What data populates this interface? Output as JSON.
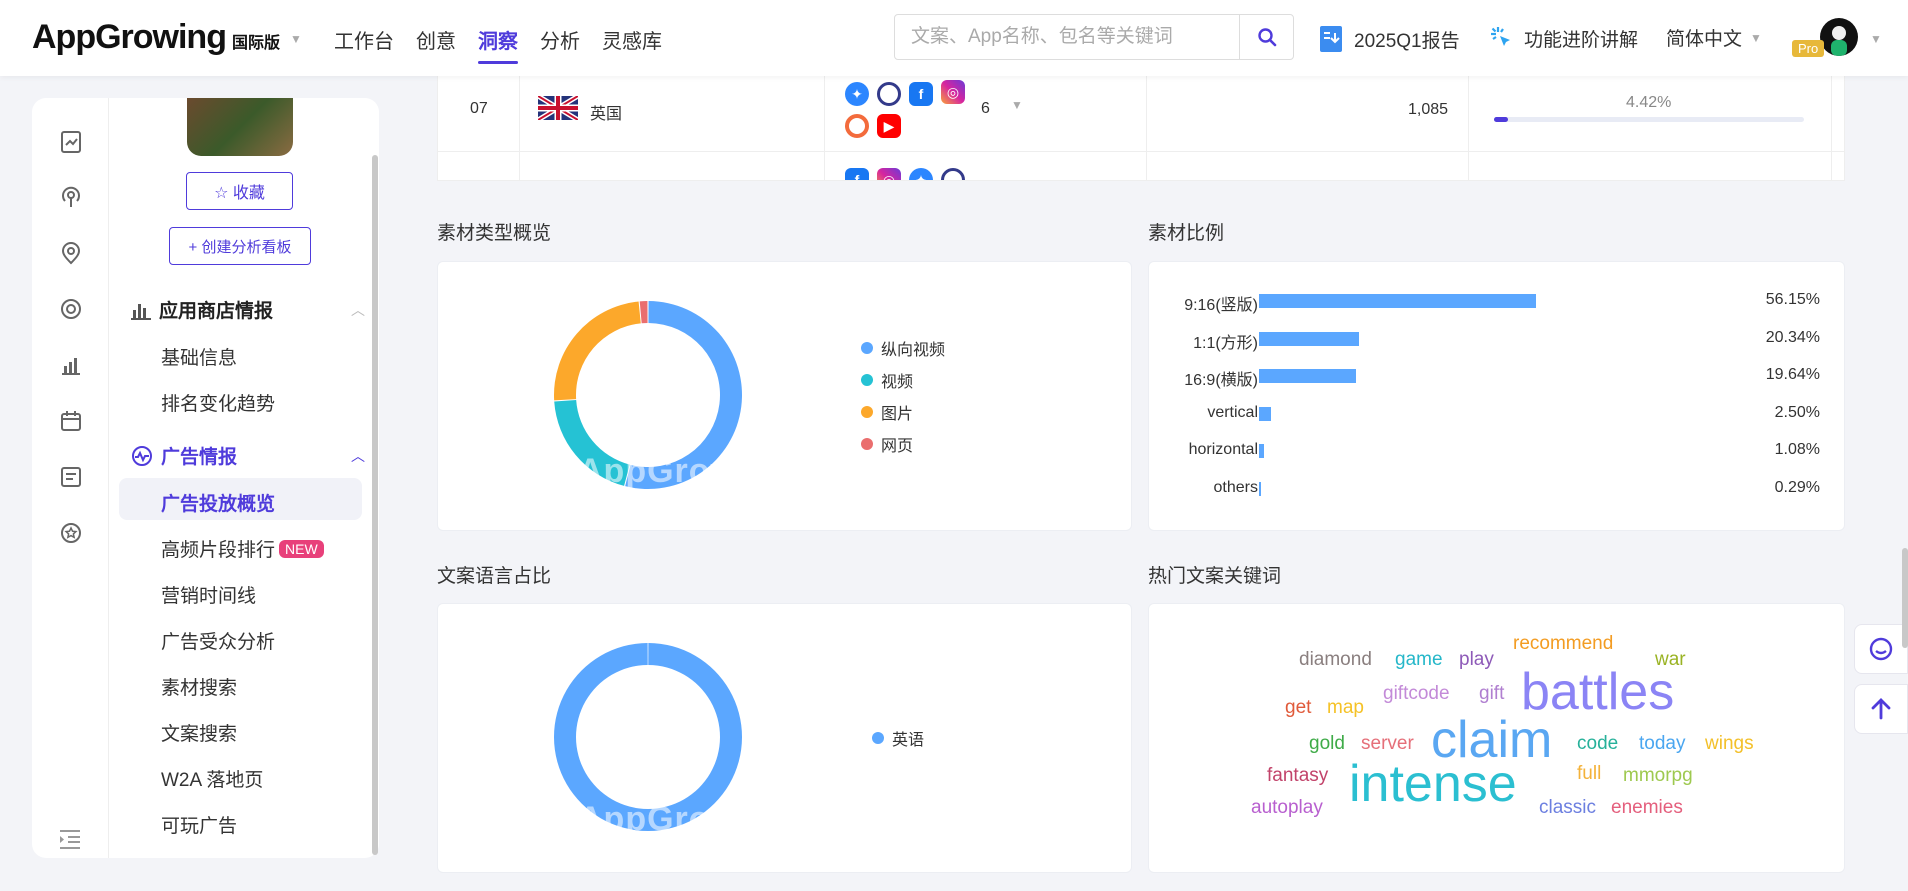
{
  "header": {
    "logo": "AppGrowing",
    "logo_edition": "国际版",
    "nav": [
      "工作台",
      "创意",
      "洞察",
      "分析",
      "灵感库"
    ],
    "active_nav": "洞察",
    "search_placeholder": "文案、App名称、包名等关键词",
    "report_link": "2025Q1报告",
    "feature_link": "功能进阶讲解",
    "language": "简体中文",
    "pro_badge": "Pro"
  },
  "sidebar": {
    "favorite_button": "☆ 收藏",
    "create_board_button": "+ 创建分析看板",
    "sections": [
      {
        "title": "应用商店情报",
        "items": [
          "基础信息",
          "排名变化趋势"
        ]
      },
      {
        "title": "广告情报",
        "items": [
          "广告投放概览",
          "高频片段排行",
          "营销时间线",
          "广告受众分析",
          "素材搜索",
          "文案搜索",
          "W2A 落地页",
          "可玩广告"
        ]
      }
    ],
    "active_item": "广告投放概览",
    "new_badge": "NEW"
  },
  "table": {
    "row": {
      "rank": "07",
      "country": "英国",
      "media_count": "6",
      "ads": "1,085",
      "share": "4.42%",
      "share_value": 4.42
    }
  },
  "panels": {
    "material_type_title": "素材类型概览",
    "material_ratio_title": "素材比例",
    "copy_language_title": "文案语言占比",
    "hot_keywords_title": "热门文案关键词",
    "watermark": "AppGrowing"
  },
  "chart_data": [
    {
      "type": "pie",
      "title": "素材类型概览",
      "categories": [
        "纵向视频",
        "视频",
        "图片",
        "网页"
      ],
      "values": [
        54,
        20,
        24.5,
        1.5
      ],
      "colors": [
        "#5ba7ff",
        "#25c2d4",
        "#fca82b",
        "#ea6e6e"
      ],
      "legend": "right"
    },
    {
      "type": "bar",
      "title": "素材比例",
      "categories": [
        "9:16(竖版)",
        "1:1(方形)",
        "16:9(横版)",
        "vertical",
        "horizontal",
        "others"
      ],
      "values": [
        56.15,
        20.34,
        19.64,
        2.5,
        1.08,
        0.29
      ],
      "labels": [
        "56.15%",
        "20.34%",
        "19.64%",
        "2.50%",
        "1.08%",
        "0.29%"
      ],
      "color": "#5ba7ff"
    },
    {
      "type": "pie",
      "title": "文案语言占比",
      "categories": [
        "英语"
      ],
      "values": [
        100
      ],
      "colors": [
        "#5ba7ff"
      ],
      "legend": "right"
    }
  ],
  "word_cloud": [
    {
      "text": "diamond",
      "color": "#8a7f7f"
    },
    {
      "text": "game",
      "color": "#25b7c9"
    },
    {
      "text": "play",
      "color": "#8e5ab8"
    },
    {
      "text": "recommend",
      "color": "#f39c22"
    },
    {
      "text": "war",
      "color": "#9ab324"
    },
    {
      "text": "get",
      "color": "#e05a3a"
    },
    {
      "text": "map",
      "color": "#f5c227"
    },
    {
      "text": "giftcode",
      "color": "#c38ad8"
    },
    {
      "text": "gift",
      "color": "#b07fd0"
    },
    {
      "text": "battles",
      "color": "#8b84f5"
    },
    {
      "text": "gold",
      "color": "#3fab48"
    },
    {
      "text": "server",
      "color": "#e56f79"
    },
    {
      "text": "claim",
      "color": "#5aa7f2"
    },
    {
      "text": "code",
      "color": "#27b19a"
    },
    {
      "text": "today",
      "color": "#4aa6f0"
    },
    {
      "text": "wings",
      "color": "#f3c02a"
    },
    {
      "text": "fantasy",
      "color": "#c2436a"
    },
    {
      "text": "intense",
      "color": "#2bbfd1"
    },
    {
      "text": "full",
      "color": "#f4b23a"
    },
    {
      "text": "mmorpg",
      "color": "#9ec94f"
    },
    {
      "text": "autoplay",
      "color": "#b85fcf"
    },
    {
      "text": "classic",
      "color": "#6c7fe0"
    },
    {
      "text": "enemies",
      "color": "#e45f7d"
    }
  ]
}
